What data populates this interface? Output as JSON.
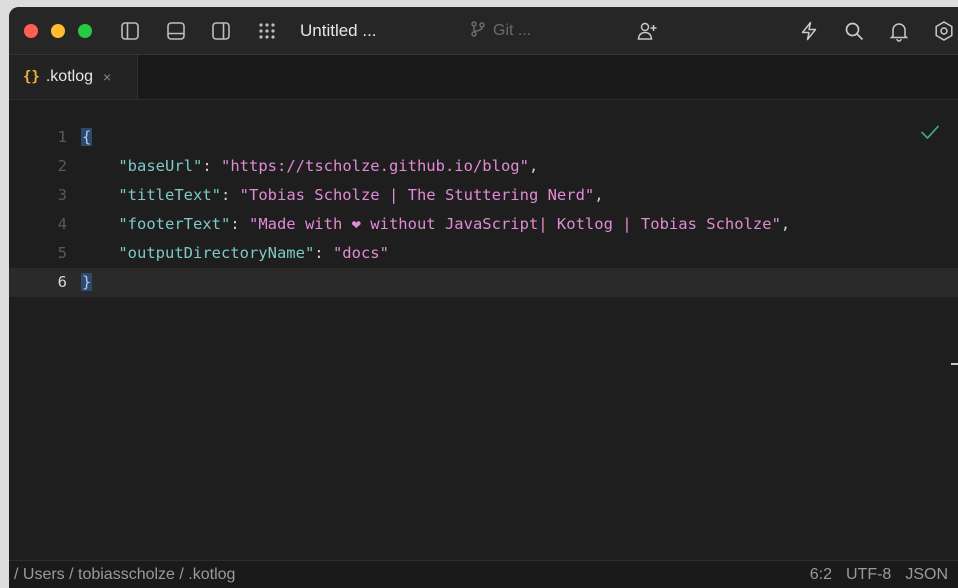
{
  "window": {
    "title": "Untitled ...",
    "git_label": "Git ..."
  },
  "icons": {
    "sidebar_left": "sidebar-left-icon",
    "panel_bottom": "panel-bottom-icon",
    "sidebar_right": "sidebar-right-icon",
    "grid": "grid-icon",
    "git_branch": "git-branch-icon",
    "add_user": "add-user-icon",
    "lightning": "lightning-icon",
    "search": "search-icon",
    "bell": "bell-icon",
    "settings": "settings-icon",
    "check": "checkmark-icon",
    "json_braces": "json-braces-icon"
  },
  "tabs": [
    {
      "icon_text": "{}",
      "label": ".kotlog",
      "close": "×"
    }
  ],
  "editor": {
    "lines": [
      {
        "number": "1",
        "parts": [
          {
            "t": "{",
            "c": "brace-hl"
          }
        ]
      },
      {
        "number": "2",
        "parts": [
          {
            "t": "    ",
            "c": ""
          },
          {
            "t": "\"baseUrl\"",
            "c": "key"
          },
          {
            "t": ": ",
            "c": "punct"
          },
          {
            "t": "\"https://tscholze.github.io/blog\"",
            "c": "str"
          },
          {
            "t": ",",
            "c": "punct"
          }
        ]
      },
      {
        "number": "3",
        "parts": [
          {
            "t": "    ",
            "c": ""
          },
          {
            "t": "\"titleText\"",
            "c": "key"
          },
          {
            "t": ": ",
            "c": "punct"
          },
          {
            "t": "\"Tobias Scholze | The Stuttering Nerd\"",
            "c": "str"
          },
          {
            "t": ",",
            "c": "punct"
          }
        ]
      },
      {
        "number": "4",
        "parts": [
          {
            "t": "    ",
            "c": ""
          },
          {
            "t": "\"footerText\"",
            "c": "key"
          },
          {
            "t": ": ",
            "c": "punct"
          },
          {
            "t": "\"Made with ❤ without JavaScript| Kotlog | Tobias Scholze\"",
            "c": "str"
          },
          {
            "t": ",",
            "c": "punct"
          }
        ]
      },
      {
        "number": "5",
        "parts": [
          {
            "t": "    ",
            "c": ""
          },
          {
            "t": "\"outputDirectoryName\"",
            "c": "key"
          },
          {
            "t": ": ",
            "c": "punct"
          },
          {
            "t": "\"docs\"",
            "c": "str"
          }
        ]
      },
      {
        "number": "6",
        "parts": [
          {
            "t": "}",
            "c": "brace-hl"
          }
        ],
        "active": true
      }
    ]
  },
  "status": {
    "breadcrumb": "/ Users / tobiasscholze / .kotlog",
    "cursor": "6:2",
    "encoding": "UTF-8",
    "language": "JSON"
  },
  "colors": {
    "background": "#1e1e1e",
    "key": "#7ec8c8",
    "string": "#e28ad6",
    "tab_icon": "#f2b33d",
    "check": "#3fa37a"
  }
}
